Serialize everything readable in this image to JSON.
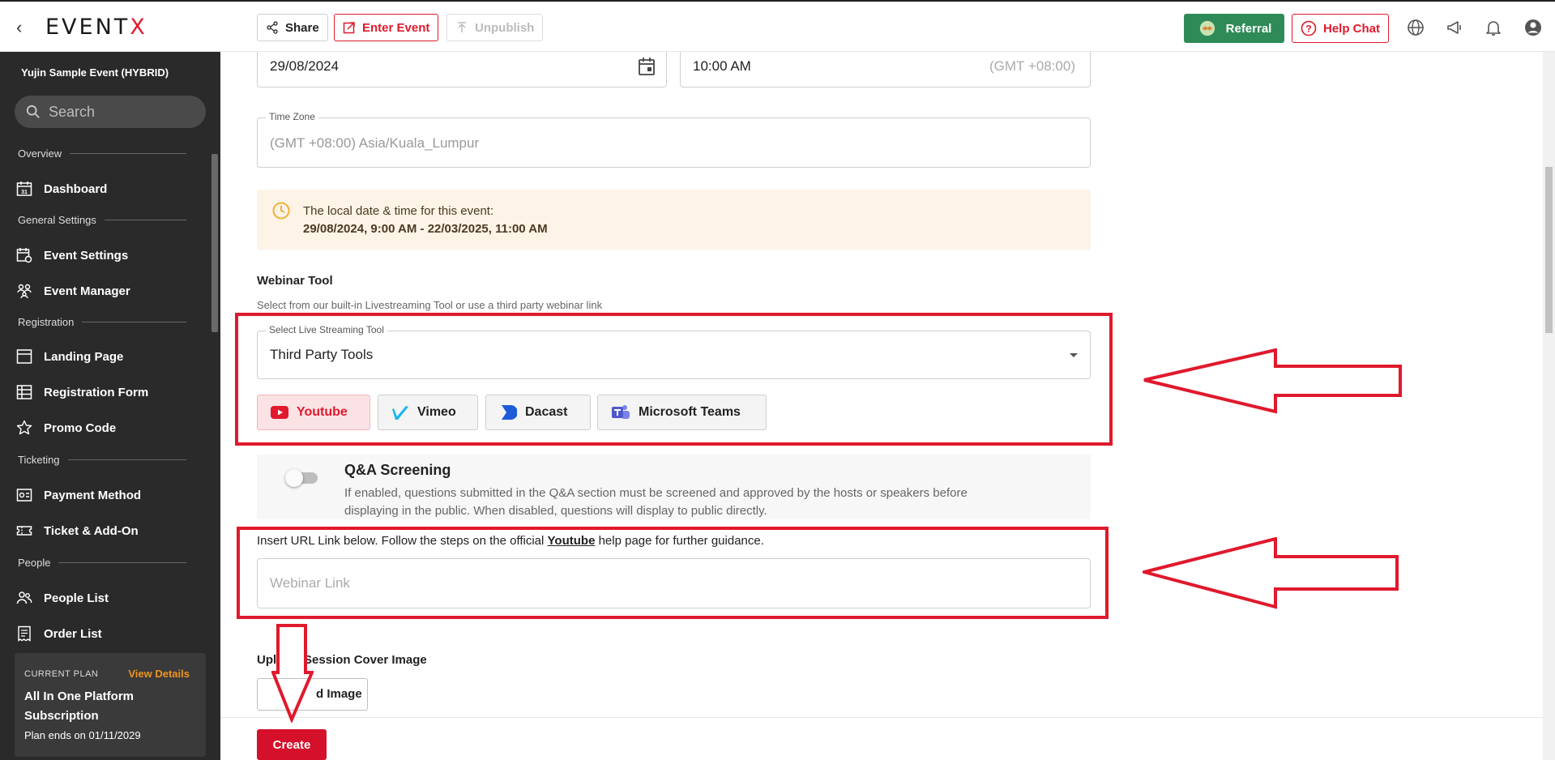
{
  "topbar": {
    "logo_main": "EVENT",
    "logo_x": "X",
    "share": "Share",
    "enter_event": "Enter Event",
    "unpublish": "Unpublish",
    "referral": "Referral",
    "help_chat": "Help Chat"
  },
  "sidebar": {
    "event_name": "Yujin Sample Event (HYBRID)",
    "search_placeholder": "Search",
    "sections": {
      "overview": "Overview",
      "general": "General Settings",
      "registration": "Registration",
      "ticketing": "Ticketing",
      "people": "People"
    },
    "items": {
      "dashboard": "Dashboard",
      "event_settings": "Event Settings",
      "event_manager": "Event Manager",
      "landing_page": "Landing Page",
      "registration_form": "Registration Form",
      "promo_code": "Promo Code",
      "payment_method": "Payment Method",
      "ticket_addon": "Ticket & Add-On",
      "people_list": "People List",
      "order_list": "Order List"
    },
    "plan": {
      "label": "CURRENT PLAN",
      "view_details": "View Details",
      "name": "All In One Platform Subscription",
      "ends": "Plan ends on 01/11/2029"
    }
  },
  "form": {
    "date_value": "29/08/2024",
    "time_value": "10:00 AM",
    "time_gmt": "(GMT +08:00)",
    "timezone_legend": "Time Zone",
    "timezone_value": "(GMT +08:00) Asia/Kuala_Lumpur",
    "notice_line1": "The local date & time for this event:",
    "notice_line2": "29/08/2024, 9:00 AM - 22/03/2025, 11:00 AM",
    "webinar_title": "Webinar Tool",
    "webinar_sub": "Select from our built-in Livestreaming Tool or use a third party webinar link",
    "stream_legend": "Select Live Streaming Tool",
    "stream_value": "Third Party Tools",
    "tools": [
      "Youtube",
      "Vimeo",
      "Dacast",
      "Microsoft Teams"
    ],
    "qa_title": "Q&A Screening",
    "qa_desc_1": "If enabled, questions submitted in the Q&A section must be screened and approved by the hosts or speakers before",
    "qa_desc_2": "displaying in the public. When disabled, questions will display to public directly.",
    "url_prefix": "Insert URL Link below. Follow the steps on the official ",
    "url_link": "Youtube",
    "url_suffix": " help page for further guidance.",
    "webinar_link_placeholder": "Webinar Link",
    "cover_title_visible": "Upl",
    "cover_title_visible_2": "Session Cover Image",
    "upload_btn": "d Image",
    "create": "Create"
  },
  "colors": {
    "accent_red": "#e0192c",
    "referral_green": "#2e8b57",
    "sidebar_bg": "#2a2a2a",
    "notice_bg": "#fdf3e6",
    "plan_orange": "#f0941c"
  }
}
